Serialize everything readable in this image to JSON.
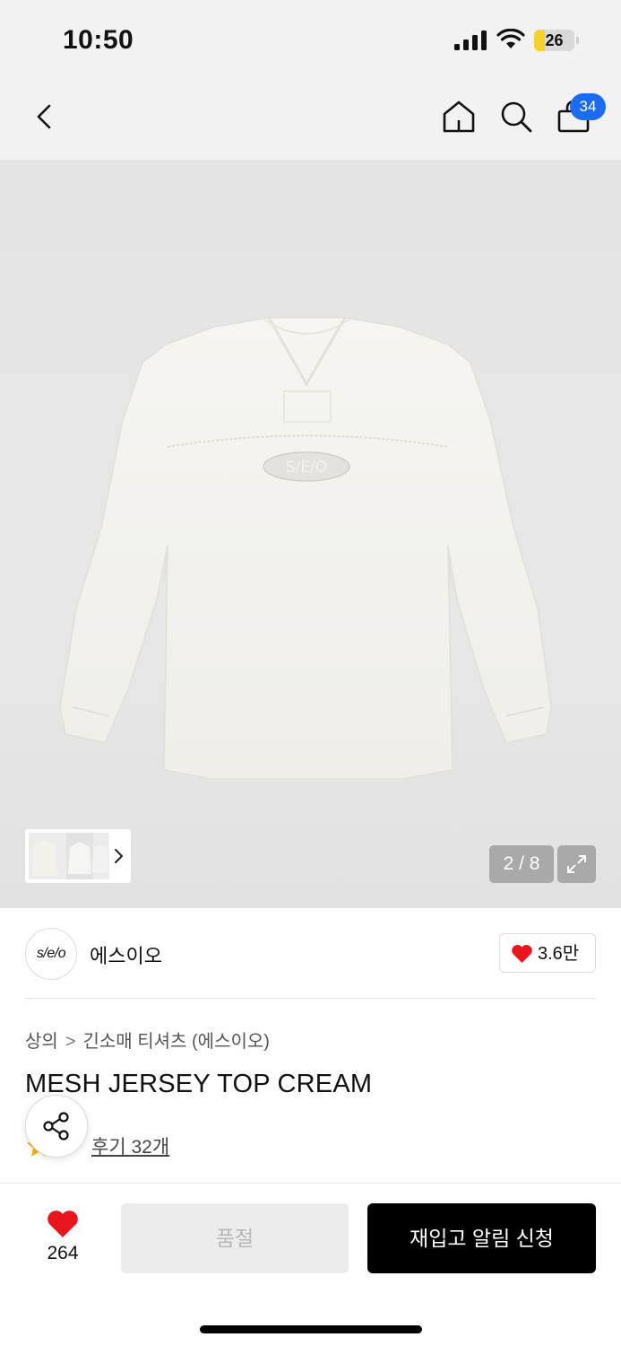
{
  "status_bar": {
    "time": "10:50",
    "battery_level": "26",
    "icons": [
      "signal-icon",
      "wifi-icon",
      "battery-icon"
    ]
  },
  "nav": {
    "icons": [
      "back-icon",
      "home-icon",
      "search-icon",
      "cart-icon"
    ],
    "cart_badge": "34"
  },
  "gallery": {
    "counter": "2 / 8",
    "icons": [
      "expand-icon",
      "chevron-right-icon"
    ]
  },
  "brand": {
    "logo_text": "s/e/o",
    "name": "에스이오",
    "likes": "3.6만",
    "like_icon": "heart-icon"
  },
  "product": {
    "breadcrumb": [
      "상의",
      "긴소매 티셔츠 (에스이오)"
    ],
    "title": "MESH JERSEY TOP CREAM",
    "review_label": "후기 32개",
    "share_icon": "share-icon",
    "star_icon": "star-icon"
  },
  "bottom_bar": {
    "wish_count": "264",
    "soldout_label": "품절",
    "restock_label": "재입고 알림 신청"
  },
  "colors": {
    "accent_badge": "#1b6bf5",
    "heart": "#e8141e",
    "battery": "#f5d12b",
    "primary_button": "#000000"
  }
}
